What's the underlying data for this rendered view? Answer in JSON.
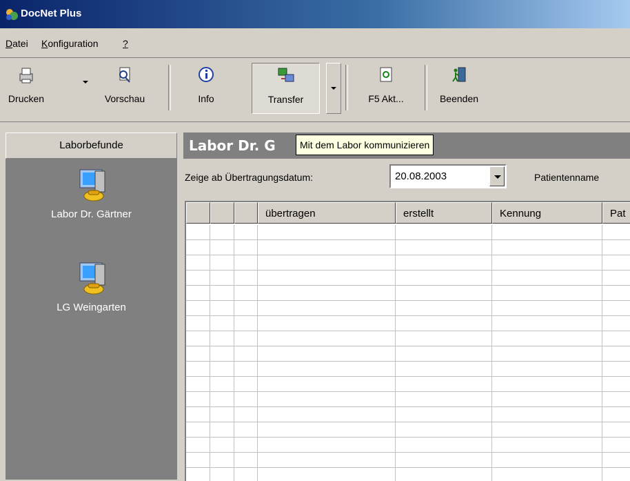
{
  "window": {
    "title": "DocNet Plus"
  },
  "menu": [
    {
      "label": "Datei",
      "accel": "D"
    },
    {
      "label": "Konfiguration",
      "accel": "K"
    },
    {
      "label": "?",
      "accel": "?"
    }
  ],
  "toolbar": {
    "print_label": "Drucken",
    "preview_label": "Vorschau",
    "info_label": "Info",
    "transfer_label": "Transfer",
    "refresh_label": "F5 Akt...",
    "exit_label": "Beenden"
  },
  "sidebar": {
    "header": "Laborbefunde",
    "items": [
      {
        "label": "Labor Dr. Gärtner",
        "icon": "lab-computer-phone-icon"
      },
      {
        "label": "LG Weingarten",
        "icon": "lab-computer-phone-icon"
      }
    ]
  },
  "main": {
    "title": "Labor Dr. G",
    "tooltip": "Mit dem Labor kommunizieren",
    "filter_label": "Zeige ab Übertragungsdatum:",
    "date_value": "20.08.2003",
    "patient_label": "Patientenname",
    "columns": [
      "",
      "",
      "",
      "übertragen",
      "erstellt",
      "Kennung",
      "Pat"
    ]
  },
  "colors": {
    "title_gradient_start": "#0a246a",
    "face": "#d4d0c8",
    "dark_panel": "#808080",
    "tooltip_bg": "#ffffe1"
  }
}
